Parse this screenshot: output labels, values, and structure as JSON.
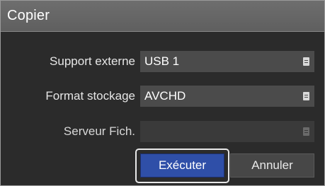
{
  "dialog": {
    "title": "Copier"
  },
  "fields": [
    {
      "label": "Support externe",
      "value": "USB 1",
      "enabled": true
    },
    {
      "label": "Format stockage",
      "value": "AVCHD",
      "enabled": true
    },
    {
      "label": "Serveur Fich.",
      "value": "",
      "enabled": false
    }
  ],
  "buttons": {
    "execute_label": "Exécuter",
    "cancel_label": "Annuler"
  },
  "icons": {
    "dropdown": "list-icon"
  },
  "colors": {
    "primary_button": "#2f4fa8",
    "title_bar": "#666666",
    "background": "#2b2b2b"
  }
}
